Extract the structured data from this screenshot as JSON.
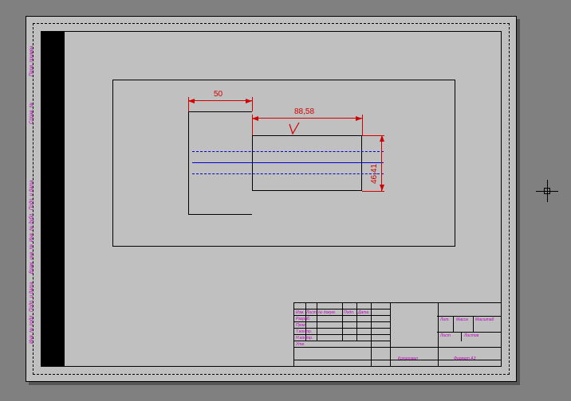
{
  "dimensions": {
    "d50": "50",
    "d8858": "88,58",
    "d4641": "46,41"
  },
  "leftstrip": {
    "l1": "Инв. № подл.",
    "l2": "Подп. и дата",
    "l3": "Взам. инв. №",
    "l4": "Инв. № дубл.",
    "l5": "Подп. и дата",
    "l6": "Справ. №",
    "l7": "Перв. примен."
  },
  "titleblock": {
    "r1c1": "Изм.",
    "r1c2": "Лист",
    "r1c3": "№ докум.",
    "r1c4": "Подп.",
    "r1c5": "Дата",
    "r2": "Разраб.",
    "r3": "Пров.",
    "r4": "Т.контр.",
    "r5": "Н.контр.",
    "r6": "Утв.",
    "rtop1": "Лит.",
    "rtop2": "Масса",
    "rtop3": "Масштаб",
    "rmid1": "Лист",
    "rmid2": "Листов",
    "rbot1": "Копировал",
    "rbot2": "Формат А3"
  }
}
